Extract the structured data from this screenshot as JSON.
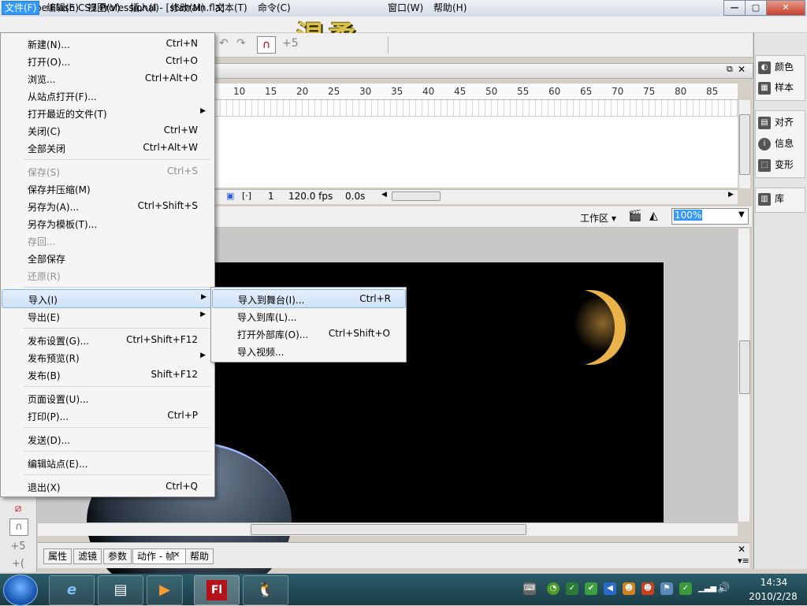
{
  "window": {
    "app_icon": "Fl",
    "title": "Adobe Flash CS3 Professional - [starrain.fla]",
    "minimize": "—",
    "maximize": "▢",
    "close": "✕"
  },
  "menubar": {
    "items": [
      {
        "label": "文件(F)"
      },
      {
        "label": "编辑(E)"
      },
      {
        "label": "视图(V)"
      },
      {
        "label": "插入(I)"
      },
      {
        "label": "修改(M)"
      },
      {
        "label": "文本(T)"
      },
      {
        "label": "命令(C)"
      },
      {
        "label": "窗口(W)"
      },
      {
        "label": "帮助(H)"
      }
    ],
    "watermark": "温柔"
  },
  "file_menu": {
    "items": [
      {
        "label": "新建(N)...",
        "shortcut": "Ctrl+N"
      },
      {
        "label": "打开(O)...",
        "shortcut": "Ctrl+O"
      },
      {
        "label": "浏览...",
        "shortcut": "Ctrl+Alt+O"
      },
      {
        "label": "从站点打开(F)...",
        "shortcut": ""
      },
      {
        "label": "打开最近的文件(T)",
        "shortcut": ""
      },
      {
        "label": "关闭(C)",
        "shortcut": "Ctrl+W"
      },
      {
        "label": "全部关闭",
        "shortcut": "Ctrl+Alt+W"
      },
      {
        "label": "保存(S)",
        "shortcut": "Ctrl+S"
      },
      {
        "label": "保存并压缩(M)",
        "shortcut": ""
      },
      {
        "label": "另存为(A)...",
        "shortcut": "Ctrl+Shift+S"
      },
      {
        "label": "另存为模板(T)...",
        "shortcut": ""
      },
      {
        "label": "存回...",
        "shortcut": ""
      },
      {
        "label": "全部保存",
        "shortcut": ""
      },
      {
        "label": "还原(R)",
        "shortcut": ""
      },
      {
        "label": "导入(I)",
        "shortcut": ""
      },
      {
        "label": "导出(E)",
        "shortcut": ""
      },
      {
        "label": "发布设置(G)...",
        "shortcut": "Ctrl+Shift+F12"
      },
      {
        "label": "发布预览(R)",
        "shortcut": ""
      },
      {
        "label": "发布(B)",
        "shortcut": "Shift+F12"
      },
      {
        "label": "页面设置(U)...",
        "shortcut": ""
      },
      {
        "label": "打印(P)...",
        "shortcut": "Ctrl+P"
      },
      {
        "label": "发送(D)...",
        "shortcut": ""
      },
      {
        "label": "编辑站点(E)...",
        "shortcut": ""
      },
      {
        "label": "退出(X)",
        "shortcut": "Ctrl+Q"
      }
    ],
    "submenu_arrow": "▶"
  },
  "import_menu": {
    "items": [
      {
        "label": "导入到舞台(I)...",
        "shortcut": "Ctrl+R"
      },
      {
        "label": "导入到库(L)...",
        "shortcut": ""
      },
      {
        "label": "打开外部库(O)...",
        "shortcut": "Ctrl+Shift+O"
      },
      {
        "label": "导入视频...",
        "shortcut": ""
      }
    ]
  },
  "timeline": {
    "ruler_ticks": [
      "10",
      "15",
      "20",
      "25",
      "30",
      "35",
      "40",
      "45",
      "50",
      "55",
      "60",
      "65",
      "70",
      "75",
      "80",
      "85"
    ],
    "current_frame": "1",
    "fps": "120.0 fps",
    "elapsed": "0.0s"
  },
  "stage_bar": {
    "workspace_label": "工作区",
    "zoom": "100%"
  },
  "right_panel": {
    "items": [
      {
        "label": "颜色",
        "icon": "palette-icon"
      },
      {
        "label": "样本",
        "icon": "swatches-icon"
      },
      {
        "label": "对齐",
        "icon": "align-icon"
      },
      {
        "label": "信息",
        "icon": "info-icon"
      },
      {
        "label": "变形",
        "icon": "transform-icon"
      },
      {
        "label": "库",
        "icon": "library-icon"
      }
    ]
  },
  "bottom_tabs": [
    {
      "label": "属性"
    },
    {
      "label": "滤镜"
    },
    {
      "label": "参数"
    },
    {
      "label": "动作 - 帧"
    },
    {
      "label": "帮助"
    }
  ],
  "taskbar": {
    "flash_label": "Fl",
    "time": "14:34",
    "date": "2010/2/28"
  },
  "colors": {
    "menu_highlight": "#3399ff",
    "flash_red": "#b5121b",
    "taskbar": "#1b3c47"
  }
}
